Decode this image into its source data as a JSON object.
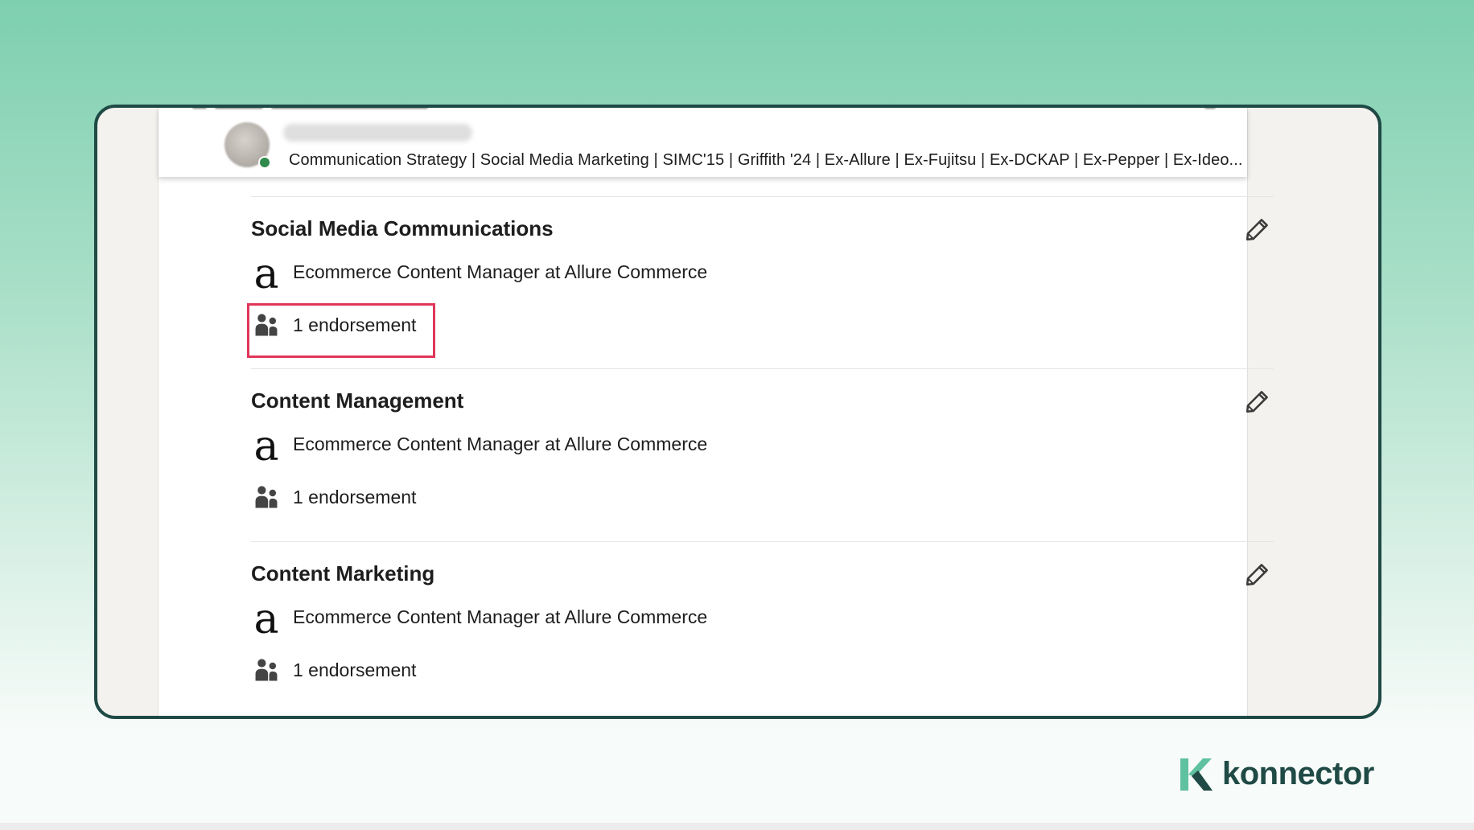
{
  "header": {
    "headline": "Communication Strategy | Social Media Marketing | SIMC'15 | Griffith '24 | Ex-Allure | Ex-Fujitsu | Ex-DCKAP | Ex-Pepper | Ex-Ideo..."
  },
  "skills": [
    {
      "title": "Social Media Communications",
      "company": "Ecommerce Content Manager at Allure Commerce",
      "endorsements": "1 endorsement"
    },
    {
      "title": "Content Management",
      "company": "Ecommerce Content Manager at Allure Commerce",
      "endorsements": "1 endorsement"
    },
    {
      "title": "Content Marketing",
      "company": "Ecommerce Content Manager at Allure Commerce",
      "endorsements": "1 endorsement"
    }
  ],
  "company_logo_glyph": "a",
  "icons": {
    "edit": "pencil-icon",
    "endorsement": "people-icon",
    "presence": "online-status-dot"
  },
  "brand": {
    "name": "konnector",
    "color": "#1f4a45",
    "accent": "#5fc1a0"
  },
  "colors": {
    "frame_border": "#1f4a45",
    "highlight": "#e0365a",
    "background_top": "#7ecfb0"
  }
}
